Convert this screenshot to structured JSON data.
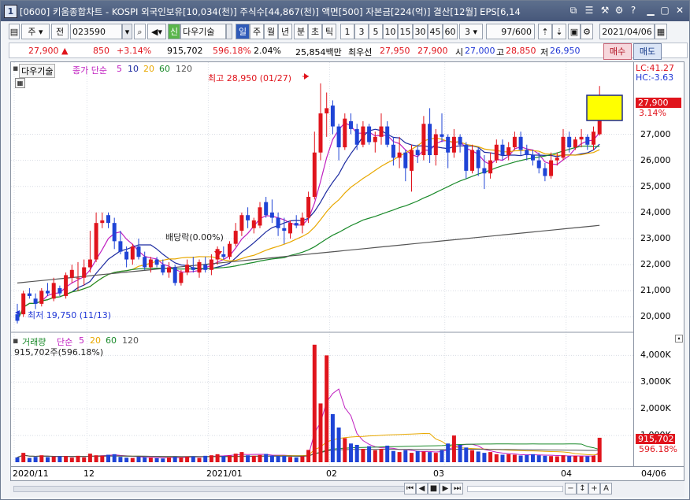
{
  "title": {
    "number": "1",
    "text": "[0600] 키움종합차트 - KOSPI 외국인보유[10,034(천)] 주식수[44,867(천)] 액면[500] 자본금[224(억)] 결산[12월] EPS[6,14"
  },
  "toolbar": {
    "type": "주",
    "market": "전",
    "code": "023590",
    "new_label": "신",
    "name": "다우기술",
    "periods": [
      "일",
      "주",
      "월",
      "년",
      "분",
      "초",
      "틱"
    ],
    "minutes": [
      "1",
      "3",
      "5",
      "10",
      "15",
      "30",
      "45",
      "60"
    ],
    "count_sel": "3",
    "count": "97/600",
    "date": "2021/04/06"
  },
  "quote": {
    "price": "27,900",
    "arrow": "▲",
    "change": "850",
    "change_pct": "+3.14%",
    "volume": "915,702",
    "vol_ratio": "596.18%",
    "turnover": "2.04%",
    "amount": "25,854백만",
    "best_label": "최우선",
    "ask": "27,950",
    "bid": "27,900",
    "open_label": "시",
    "open": "27,000",
    "high_label": "고",
    "high": "28,850",
    "low_label": "저",
    "low": "26,950",
    "buy_label": "매수",
    "sell_label": "매도"
  },
  "legend": {
    "name": "다우기술",
    "series_label": "종가 단순",
    "ma": [
      "5",
      "10",
      "20",
      "60",
      "120"
    ],
    "vol_label": "거래량",
    "vol_series_label": "단순",
    "vol_ma": [
      "5",
      "20",
      "60",
      "120"
    ],
    "vol_value": "915,702주(596.18%)"
  },
  "annotations": {
    "high": "최고 28,950 (01/27)",
    "low": "최저 19,750 (11/13)",
    "dividend": "배당락(0.00%)"
  },
  "right_axis": {
    "lc": "LC:41.27",
    "hc": "HC:-3.63",
    "price_tag": "27,900",
    "pct_tag": "3.14%",
    "price_ticks": [
      "27,000",
      "26,000",
      "25,000",
      "24,000",
      "23,000",
      "22,000",
      "21,000",
      "20,000"
    ],
    "vol_ticks": [
      "4,000K",
      "3,000K",
      "2,000K",
      "1,000K"
    ],
    "vol_tag": "915,702",
    "vol_pct_tag": "596.18%"
  },
  "x_axis": {
    "labels": [
      "2020/11",
      "12",
      "2021/01",
      "02",
      "03",
      "04"
    ],
    "right_label": "04/06"
  },
  "colors": {
    "up": "#e0141c",
    "down": "#1f44d6",
    "ma5": "#c020c0",
    "ma10": "#1c2aa0",
    "ma20": "#e8a800",
    "ma60": "#1a8a2a",
    "ma120": "#555555"
  },
  "chart_data": {
    "type": "candlestick",
    "period": "daily",
    "price_ylim": [
      19500,
      29400
    ],
    "volume_ylim": [
      0,
      4600000
    ],
    "grid": true,
    "legend_position": "top-left",
    "x_ticks": [
      "2020/11",
      "12",
      "2021/01",
      "02",
      "03",
      "04"
    ],
    "price_ticks": [
      20000,
      21000,
      22000,
      23000,
      24000,
      25000,
      26000,
      27000
    ],
    "volume_ticks": [
      1000000,
      2000000,
      3000000,
      4000000
    ],
    "candles": [
      {
        "o": 20100,
        "h": 20500,
        "l": 19750,
        "c": 19850
      },
      {
        "o": 20100,
        "h": 21000,
        "l": 20000,
        "c": 20900
      },
      {
        "o": 20900,
        "h": 21100,
        "l": 20700,
        "c": 20800
      },
      {
        "o": 20700,
        "h": 20900,
        "l": 20300,
        "c": 20500
      },
      {
        "o": 20500,
        "h": 21100,
        "l": 20400,
        "c": 21000
      },
      {
        "o": 21000,
        "h": 21300,
        "l": 20800,
        "c": 20900
      },
      {
        "o": 20700,
        "h": 21500,
        "l": 20600,
        "c": 21300
      },
      {
        "o": 21100,
        "h": 21200,
        "l": 20800,
        "c": 20900
      },
      {
        "o": 20800,
        "h": 21700,
        "l": 20700,
        "c": 21600
      },
      {
        "o": 21500,
        "h": 22000,
        "l": 21300,
        "c": 21800
      },
      {
        "o": 21500,
        "h": 22100,
        "l": 21000,
        "c": 21500
      },
      {
        "o": 21500,
        "h": 22200,
        "l": 21200,
        "c": 21900
      },
      {
        "o": 21900,
        "h": 23300,
        "l": 21700,
        "c": 22200
      },
      {
        "o": 22200,
        "h": 24000,
        "l": 22100,
        "c": 23600
      },
      {
        "o": 23600,
        "h": 24000,
        "l": 23400,
        "c": 23700
      },
      {
        "o": 23900,
        "h": 24000,
        "l": 23400,
        "c": 23600
      },
      {
        "o": 23600,
        "h": 23800,
        "l": 22600,
        "c": 22900
      },
      {
        "o": 22900,
        "h": 23300,
        "l": 22400,
        "c": 22500
      },
      {
        "o": 22500,
        "h": 22700,
        "l": 21900,
        "c": 22200
      },
      {
        "o": 22200,
        "h": 22800,
        "l": 22000,
        "c": 22700
      },
      {
        "o": 22700,
        "h": 23000,
        "l": 22200,
        "c": 22300
      },
      {
        "o": 22300,
        "h": 22500,
        "l": 21800,
        "c": 21900
      },
      {
        "o": 21900,
        "h": 22300,
        "l": 21700,
        "c": 22200
      },
      {
        "o": 22200,
        "h": 22300,
        "l": 21900,
        "c": 22000
      },
      {
        "o": 22000,
        "h": 22200,
        "l": 21600,
        "c": 21700
      },
      {
        "o": 21700,
        "h": 22100,
        "l": 21500,
        "c": 21900
      },
      {
        "o": 21900,
        "h": 22000,
        "l": 21200,
        "c": 21300
      },
      {
        "o": 21300,
        "h": 21800,
        "l": 21200,
        "c": 21700
      },
      {
        "o": 21700,
        "h": 22200,
        "l": 21600,
        "c": 22000
      },
      {
        "o": 21900,
        "h": 22300,
        "l": 21700,
        "c": 21800
      },
      {
        "o": 21700,
        "h": 22200,
        "l": 21500,
        "c": 22100
      },
      {
        "o": 22000,
        "h": 22300,
        "l": 21700,
        "c": 21800
      },
      {
        "o": 21800,
        "h": 22400,
        "l": 21600,
        "c": 22200
      },
      {
        "o": 22200,
        "h": 22700,
        "l": 22000,
        "c": 22600
      },
      {
        "o": 22400,
        "h": 22700,
        "l": 22200,
        "c": 22300
      },
      {
        "o": 22300,
        "h": 22900,
        "l": 22200,
        "c": 22800
      },
      {
        "o": 22800,
        "h": 23600,
        "l": 22700,
        "c": 23300
      },
      {
        "o": 23300,
        "h": 24000,
        "l": 23100,
        "c": 23900
      },
      {
        "o": 23900,
        "h": 24200,
        "l": 23400,
        "c": 23700
      },
      {
        "o": 23400,
        "h": 23800,
        "l": 23200,
        "c": 23700
      },
      {
        "o": 23500,
        "h": 24400,
        "l": 23400,
        "c": 24200
      },
      {
        "o": 24400,
        "h": 24600,
        "l": 23800,
        "c": 23900
      },
      {
        "o": 24000,
        "h": 24500,
        "l": 23600,
        "c": 23800
      },
      {
        "o": 23800,
        "h": 24000,
        "l": 23100,
        "c": 23400
      },
      {
        "o": 23400,
        "h": 23800,
        "l": 22800,
        "c": 23300
      },
      {
        "o": 23200,
        "h": 23700,
        "l": 23000,
        "c": 23600
      },
      {
        "o": 23600,
        "h": 23900,
        "l": 23400,
        "c": 23500
      },
      {
        "o": 23500,
        "h": 24000,
        "l": 23200,
        "c": 23800
      },
      {
        "o": 23800,
        "h": 24800,
        "l": 23600,
        "c": 24600
      },
      {
        "o": 24600,
        "h": 27100,
        "l": 24500,
        "c": 26300
      },
      {
        "o": 26300,
        "h": 28950,
        "l": 26000,
        "c": 27800
      },
      {
        "o": 27800,
        "h": 28600,
        "l": 26900,
        "c": 28000
      },
      {
        "o": 28100,
        "h": 28300,
        "l": 27000,
        "c": 27300
      },
      {
        "o": 27300,
        "h": 27400,
        "l": 26000,
        "c": 26500
      },
      {
        "o": 26500,
        "h": 27800,
        "l": 26400,
        "c": 27600
      },
      {
        "o": 27500,
        "h": 27800,
        "l": 27000,
        "c": 27200
      },
      {
        "o": 27200,
        "h": 27400,
        "l": 26400,
        "c": 26600
      },
      {
        "o": 26600,
        "h": 27500,
        "l": 26500,
        "c": 27300
      },
      {
        "o": 27300,
        "h": 27400,
        "l": 26600,
        "c": 26700
      },
      {
        "o": 26700,
        "h": 27100,
        "l": 26300,
        "c": 26900
      },
      {
        "o": 26900,
        "h": 27800,
        "l": 26600,
        "c": 27300
      },
      {
        "o": 27300,
        "h": 27500,
        "l": 26500,
        "c": 26600
      },
      {
        "o": 26600,
        "h": 26900,
        "l": 25800,
        "c": 26100
      },
      {
        "o": 26100,
        "h": 26900,
        "l": 25700,
        "c": 26300
      },
      {
        "o": 26300,
        "h": 26400,
        "l": 25200,
        "c": 25700
      },
      {
        "o": 25600,
        "h": 26600,
        "l": 24800,
        "c": 26400
      },
      {
        "o": 26400,
        "h": 26600,
        "l": 25900,
        "c": 26200
      },
      {
        "o": 26200,
        "h": 27700,
        "l": 26000,
        "c": 27400
      },
      {
        "o": 27400,
        "h": 28000,
        "l": 25900,
        "c": 26200
      },
      {
        "o": 26200,
        "h": 27200,
        "l": 25800,
        "c": 27000
      },
      {
        "o": 27000,
        "h": 27800,
        "l": 26700,
        "c": 26900
      },
      {
        "o": 26900,
        "h": 27000,
        "l": 25700,
        "c": 26300
      },
      {
        "o": 26300,
        "h": 27200,
        "l": 26100,
        "c": 26900
      },
      {
        "o": 26900,
        "h": 27000,
        "l": 26300,
        "c": 26600
      },
      {
        "o": 26600,
        "h": 26700,
        "l": 25300,
        "c": 25600
      },
      {
        "o": 25600,
        "h": 26600,
        "l": 25500,
        "c": 26400
      },
      {
        "o": 26400,
        "h": 26500,
        "l": 25400,
        "c": 25700
      },
      {
        "o": 25700,
        "h": 26200,
        "l": 24900,
        "c": 25500
      },
      {
        "o": 25500,
        "h": 26300,
        "l": 25300,
        "c": 26000
      },
      {
        "o": 26000,
        "h": 26800,
        "l": 25900,
        "c": 26600
      },
      {
        "o": 26600,
        "h": 26800,
        "l": 26000,
        "c": 26200
      },
      {
        "o": 26200,
        "h": 26700,
        "l": 26000,
        "c": 26500
      },
      {
        "o": 26500,
        "h": 27100,
        "l": 26400,
        "c": 26900
      },
      {
        "o": 26900,
        "h": 27100,
        "l": 26200,
        "c": 26400
      },
      {
        "o": 26400,
        "h": 26600,
        "l": 26000,
        "c": 26200
      },
      {
        "o": 26200,
        "h": 26400,
        "l": 25800,
        "c": 26000
      },
      {
        "o": 26000,
        "h": 26300,
        "l": 25500,
        "c": 25700
      },
      {
        "o": 25700,
        "h": 25900,
        "l": 25200,
        "c": 25400
      },
      {
        "o": 25400,
        "h": 26300,
        "l": 25300,
        "c": 26000
      },
      {
        "o": 26000,
        "h": 26300,
        "l": 25800,
        "c": 26100
      },
      {
        "o": 26100,
        "h": 27200,
        "l": 26000,
        "c": 26900
      },
      {
        "o": 26900,
        "h": 27100,
        "l": 26300,
        "c": 26500
      },
      {
        "o": 26500,
        "h": 26900,
        "l": 26400,
        "c": 26800
      },
      {
        "o": 26800,
        "h": 27200,
        "l": 26500,
        "c": 26900
      },
      {
        "o": 26900,
        "h": 27000,
        "l": 26400,
        "c": 26600
      },
      {
        "o": 26600,
        "h": 27300,
        "l": 26400,
        "c": 27100
      },
      {
        "o": 27000,
        "h": 28850,
        "l": 26950,
        "c": 27900
      }
    ],
    "volume": [
      180000,
      350000,
      160000,
      200000,
      260000,
      190000,
      210000,
      220000,
      230000,
      170000,
      240000,
      180000,
      320000,
      260000,
      240000,
      280000,
      300000,
      200000,
      170000,
      160000,
      200000,
      190000,
      170000,
      150000,
      140000,
      180000,
      200000,
      180000,
      210000,
      220000,
      160000,
      240000,
      260000,
      300000,
      230000,
      250000,
      320000,
      380000,
      260000,
      240000,
      270000,
      310000,
      250000,
      230000,
      240000,
      200000,
      180000,
      220000,
      460000,
      4400000,
      2200000,
      4000000,
      1800000,
      1300000,
      900000,
      700000,
      650000,
      500000,
      600000,
      450000,
      500000,
      620000,
      420000,
      380000,
      450000,
      350000,
      420000,
      400000,
      380000,
      350000,
      450000,
      700000,
      1000000,
      650000,
      550000,
      450000,
      400000,
      350000,
      380000,
      300000,
      280000,
      300000,
      280000,
      250000,
      270000,
      300000,
      260000,
      240000,
      230000,
      220000,
      260000,
      230000,
      240000,
      220000,
      220000,
      240000,
      915702
    ],
    "ma_periods": [
      5,
      10,
      20,
      60,
      120
    ]
  }
}
